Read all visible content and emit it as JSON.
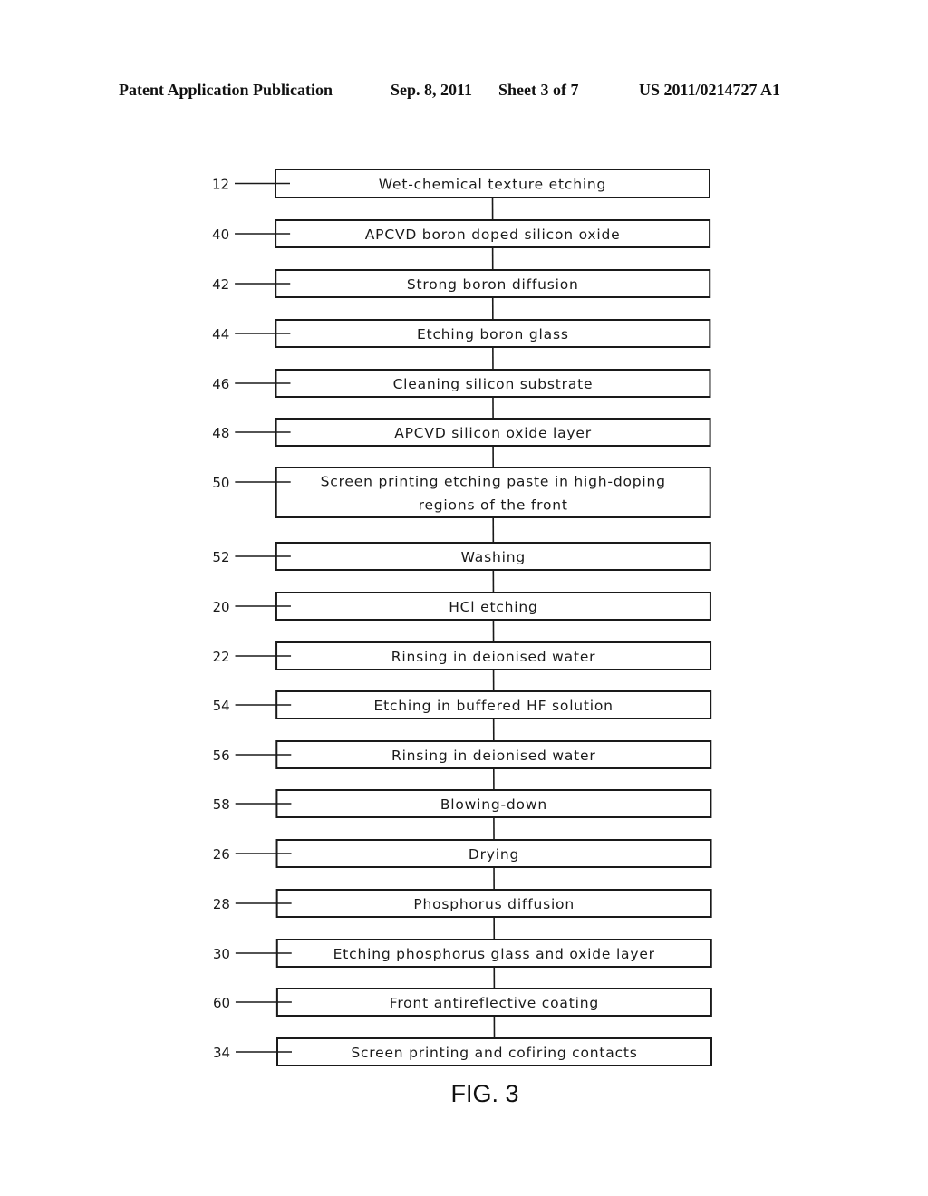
{
  "header": {
    "publication": "Patent Application Publication",
    "date": "Sep. 8, 2011",
    "sheet": "Sheet 3 of 7",
    "number": "US 2011/0214727 A1"
  },
  "figure_label": "FIG. 3",
  "flowchart": {
    "direction": "top-to-bottom",
    "steps": [
      {
        "ref": "12",
        "lines": [
          "Wet-chemical texture etching"
        ]
      },
      {
        "ref": "40",
        "lines": [
          "APCVD boron doped silicon oxide"
        ]
      },
      {
        "ref": "42",
        "lines": [
          "Strong boron diffusion"
        ]
      },
      {
        "ref": "44",
        "lines": [
          "Etching boron glass"
        ]
      },
      {
        "ref": "46",
        "lines": [
          "Cleaning silicon substrate"
        ]
      },
      {
        "ref": "48",
        "lines": [
          "APCVD silicon oxide layer"
        ]
      },
      {
        "ref": "50",
        "lines": [
          "Screen printing etching paste in high-doping",
          "regions of the front"
        ]
      },
      {
        "ref": "52",
        "lines": [
          "Washing"
        ]
      },
      {
        "ref": "20",
        "lines": [
          "HCl etching"
        ]
      },
      {
        "ref": "22",
        "lines": [
          "Rinsing in deionised water"
        ]
      },
      {
        "ref": "54",
        "lines": [
          "Etching in buffered HF solution"
        ]
      },
      {
        "ref": "56",
        "lines": [
          "Rinsing in deionised water"
        ]
      },
      {
        "ref": "58",
        "lines": [
          "Blowing-down"
        ]
      },
      {
        "ref": "26",
        "lines": [
          "Drying"
        ]
      },
      {
        "ref": "28",
        "lines": [
          "Phosphorus diffusion"
        ]
      },
      {
        "ref": "30",
        "lines": [
          "Etching phosphorus glass and oxide layer"
        ]
      },
      {
        "ref": "60",
        "lines": [
          "Front antireflective coating"
        ]
      },
      {
        "ref": "34",
        "lines": [
          "Screen printing and cofiring contacts"
        ]
      }
    ]
  }
}
